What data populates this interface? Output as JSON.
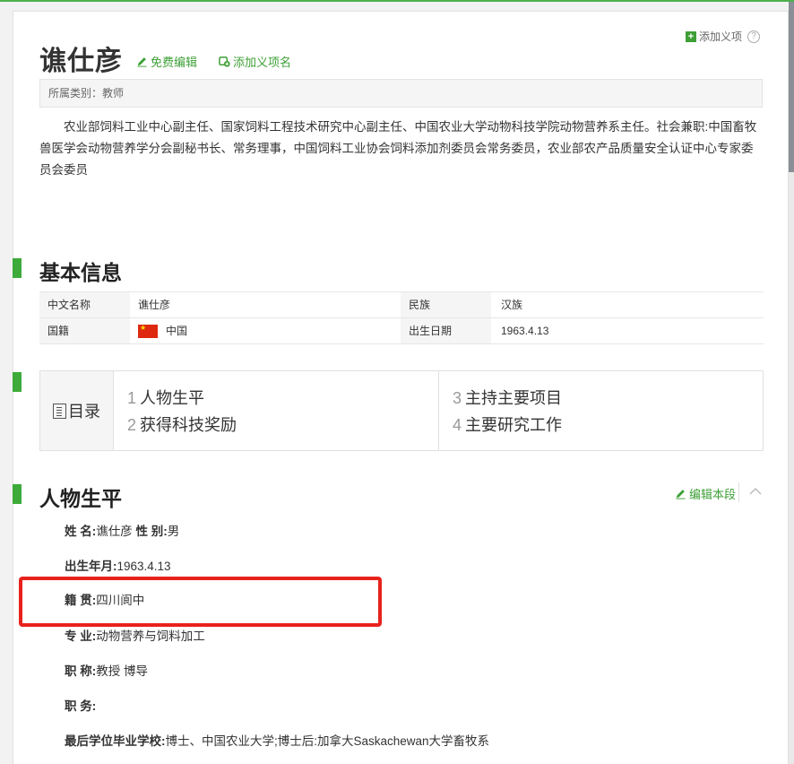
{
  "entry": {
    "title": "谯仕彦",
    "edit_link": "免费编辑",
    "add_name_link": "添加义项名",
    "add_sense": "添加义项",
    "help": "?",
    "category": "所属类别：教师",
    "summary": "农业部饲料工业中心副主任、国家饲料工程技术研究中心副主任、中国农业大学动物科技学院动物营养系主任。社会兼职:中国畜牧兽医学会动物营养学分会副秘书长、常务理事，中国饲料工业协会饲料添加剂委员会常务委员，农业部农产品质量安全认证中心专家委员会委员"
  },
  "basic_info": {
    "heading": "基本信息",
    "rows": [
      {
        "k1": "中文名称",
        "v1": "谯仕彦",
        "k2": "民族",
        "v2": "汉族"
      },
      {
        "k1": "国籍",
        "v1": "中国",
        "k2": "出生日期",
        "v2": "1963.4.13"
      }
    ]
  },
  "toc": {
    "heading": "目录",
    "items": [
      {
        "num": "1",
        "label": "人物生平"
      },
      {
        "num": "2",
        "label": "获得科技奖励"
      },
      {
        "num": "3",
        "label": "主持主要项目"
      },
      {
        "num": "4",
        "label": "主要研究工作"
      }
    ]
  },
  "biography": {
    "heading": "人物生平",
    "edit_label": "编辑本段",
    "lines": [
      {
        "label": "姓 名:",
        "value": "谯仕彦 "
      },
      {
        "label": "性 别:",
        "value": "男"
      },
      {
        "label": "出生年月:",
        "value": "1963.4.13"
      },
      {
        "label": "籍 贯:",
        "value": "四川阆中"
      },
      {
        "label": "专 业:",
        "value": "动物营养与饲料加工"
      },
      {
        "label": "职 称:",
        "value": "教授 博导"
      },
      {
        "label": "职 务:",
        "value": ""
      },
      {
        "label": "最后学位毕业学校:",
        "value": "博士、中国农业大学;博士后:加拿大Saskachewan大学畜牧系"
      }
    ]
  },
  "colors": {
    "accent": "#3daa3a",
    "link": "#3d9f36",
    "highlight": "#e8221c"
  }
}
